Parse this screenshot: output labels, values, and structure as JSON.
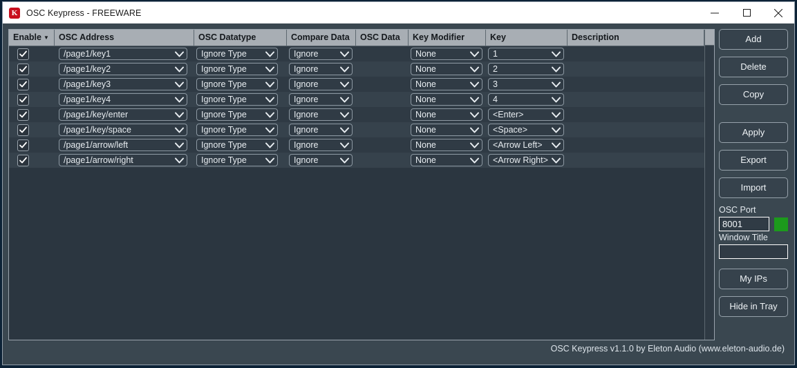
{
  "window": {
    "title": "OSC Keypress - FREEWARE",
    "icon": "app-k-icon",
    "controls": {
      "minimize": "minimize-icon",
      "maximize": "maximize-icon",
      "close": "close-icon"
    }
  },
  "table": {
    "columns": [
      {
        "label": "Enable",
        "sorted": true,
        "sort_caret": "▼"
      },
      {
        "label": "OSC Address",
        "sorted": false,
        "sort_caret": ""
      },
      {
        "label": "OSC Datatype",
        "sorted": false,
        "sort_caret": ""
      },
      {
        "label": "Compare Data",
        "sorted": false,
        "sort_caret": ""
      },
      {
        "label": "OSC Data",
        "sorted": false,
        "sort_caret": ""
      },
      {
        "label": "Key Modifier",
        "sorted": false,
        "sort_caret": ""
      },
      {
        "label": "Key",
        "sorted": false,
        "sort_caret": ""
      },
      {
        "label": "Description",
        "sorted": false,
        "sort_caret": ""
      }
    ],
    "rows": [
      {
        "enabled": true,
        "address": "/page1/key1",
        "datatype": "Ignore Type",
        "compare": "Ignore",
        "osc_data": "",
        "modifier": "None",
        "key": "1",
        "description": ""
      },
      {
        "enabled": true,
        "address": "/page1/key2",
        "datatype": "Ignore Type",
        "compare": "Ignore",
        "osc_data": "",
        "modifier": "None",
        "key": "2",
        "description": ""
      },
      {
        "enabled": true,
        "address": "/page1/key3",
        "datatype": "Ignore Type",
        "compare": "Ignore",
        "osc_data": "",
        "modifier": "None",
        "key": "3",
        "description": ""
      },
      {
        "enabled": true,
        "address": "/page1/key4",
        "datatype": "Ignore Type",
        "compare": "Ignore",
        "osc_data": "",
        "modifier": "None",
        "key": "4",
        "description": ""
      },
      {
        "enabled": true,
        "address": "/page1/key/enter",
        "datatype": "Ignore Type",
        "compare": "Ignore",
        "osc_data": "",
        "modifier": "None",
        "key": "<Enter>",
        "description": ""
      },
      {
        "enabled": true,
        "address": "/page1/key/space",
        "datatype": "Ignore Type",
        "compare": "Ignore",
        "osc_data": "",
        "modifier": "None",
        "key": "<Space>",
        "description": ""
      },
      {
        "enabled": true,
        "address": "/page1/arrow/left",
        "datatype": "Ignore Type",
        "compare": "Ignore",
        "osc_data": "",
        "modifier": "None",
        "key": "<Arrow Left>",
        "description": ""
      },
      {
        "enabled": true,
        "address": "/page1/arrow/right",
        "datatype": "Ignore Type",
        "compare": "Ignore",
        "osc_data": "",
        "modifier": "None",
        "key": "<Arrow Right>",
        "description": ""
      }
    ]
  },
  "side_panel": {
    "add_label": "Add",
    "delete_label": "Delete",
    "copy_label": "Copy",
    "apply_label": "Apply",
    "export_label": "Export",
    "import_label": "Import",
    "osc_port_label": "OSC Port",
    "osc_port_value": "8001",
    "status_led_color": "#1c9a1c",
    "window_title_label": "Window Title",
    "window_title_value": "",
    "my_ips_label": "My IPs",
    "hide_in_tray_label": "Hide in Tray"
  },
  "footer": {
    "text": "OSC Keypress v1.1.0 by Eleton Audio (www.eleton-audio.de)"
  },
  "colors": {
    "titlebar_bg": "#ffffff",
    "window_bg": "#3a4750",
    "table_header_bg": "#a8aeb4",
    "row_odd": "#2f3a44",
    "row_even": "#36424c",
    "accent_led": "#1c9a1c",
    "app_icon": "#c80f1e"
  }
}
